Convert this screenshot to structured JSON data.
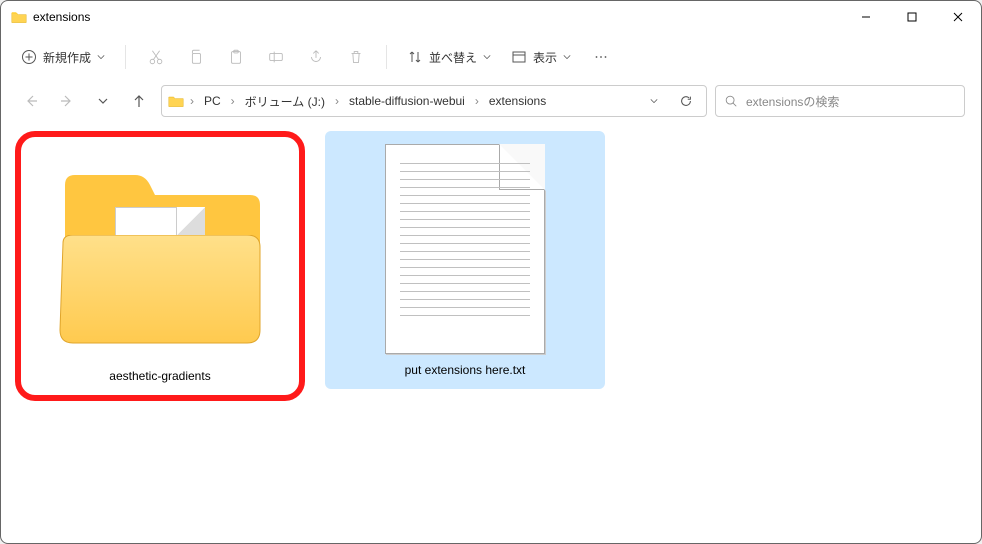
{
  "window": {
    "title": "extensions"
  },
  "toolbar": {
    "new_label": "新規作成",
    "sort_label": "並べ替え",
    "view_label": "表示"
  },
  "breadcrumb": {
    "parts": [
      "PC",
      "ボリューム (J:)",
      "stable-diffusion-webui",
      "extensions"
    ]
  },
  "search": {
    "placeholder": "extensionsの検索"
  },
  "items": [
    {
      "name": "aesthetic-gradients",
      "type": "folder",
      "highlighted": true,
      "selected": false
    },
    {
      "name": "put extensions here.txt",
      "type": "text",
      "highlighted": false,
      "selected": true
    }
  ]
}
